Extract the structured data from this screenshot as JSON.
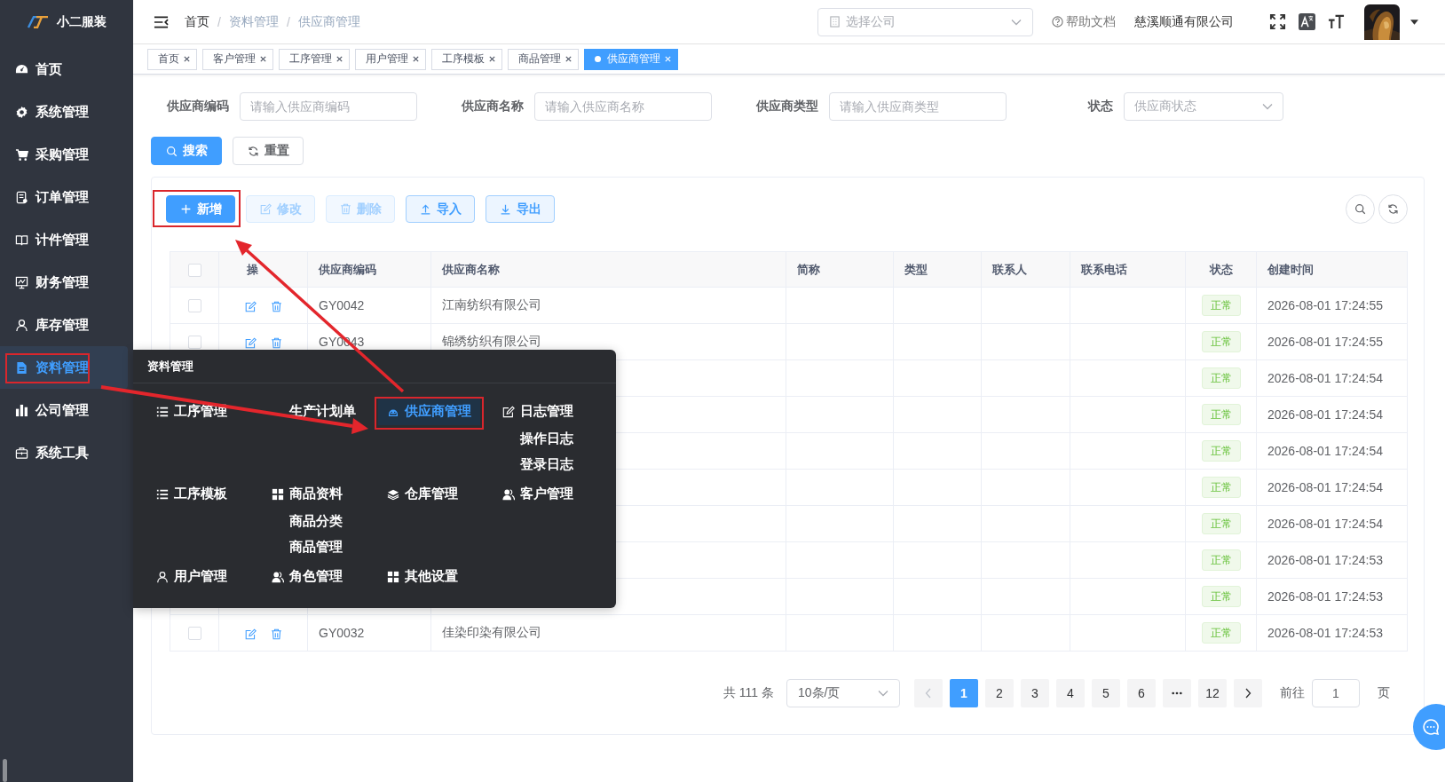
{
  "app": {
    "name": "小二服装"
  },
  "sidebar": {
    "items": [
      {
        "label": "首页",
        "selected": false
      },
      {
        "label": "系统管理",
        "selected": false
      },
      {
        "label": "采购管理",
        "selected": false
      },
      {
        "label": "订单管理",
        "selected": false
      },
      {
        "label": "计件管理",
        "selected": false
      },
      {
        "label": "财务管理",
        "selected": false
      },
      {
        "label": "库存管理",
        "selected": false
      },
      {
        "label": "资料管理",
        "selected": true
      },
      {
        "label": "公司管理",
        "selected": false
      },
      {
        "label": "系统工具",
        "selected": false
      }
    ]
  },
  "header": {
    "breadcrumb": [
      "首页",
      "资料管理",
      "供应商管理"
    ],
    "separator": "/",
    "company_select": {
      "placeholder": "选择公司"
    },
    "help": "帮助文档",
    "company": "慈溪顺通有限公司"
  },
  "tabs": [
    {
      "label": "首页",
      "selected": false
    },
    {
      "label": "客户管理",
      "selected": false
    },
    {
      "label": "工序管理",
      "selected": false
    },
    {
      "label": "用户管理",
      "selected": false
    },
    {
      "label": "工序模板",
      "selected": false
    },
    {
      "label": "商品管理",
      "selected": false
    },
    {
      "label": "供应商管理",
      "selected": true
    }
  ],
  "filters": [
    {
      "label": "供应商编码",
      "placeholder": "请输入供应商编码",
      "kind": "input"
    },
    {
      "label": "供应商名称",
      "placeholder": "请输入供应商名称",
      "kind": "input"
    },
    {
      "label": "供应商类型",
      "placeholder": "请输入供应商类型",
      "kind": "input"
    },
    {
      "label": "状态",
      "placeholder": "供应商状态",
      "kind": "select"
    }
  ],
  "search_buttons": [
    {
      "label": "搜索",
      "kind": "primary"
    },
    {
      "label": "重置",
      "kind": "default"
    }
  ],
  "toolbar": [
    {
      "label": "新增",
      "kind": "primary",
      "disabled": false
    },
    {
      "label": "修改",
      "kind": "plain",
      "disabled": true
    },
    {
      "label": "删除",
      "kind": "plain",
      "disabled": true
    },
    {
      "label": "导入",
      "kind": "plain",
      "disabled": false
    },
    {
      "label": "导出",
      "kind": "plain",
      "disabled": false
    }
  ],
  "table": {
    "select_all_checked": false,
    "columns": [
      "操",
      "供应商编码",
      "供应商名称",
      "简称",
      "类型",
      "联系人",
      "联系电话",
      "状态",
      "创建时间"
    ],
    "rows": [
      {
        "checked": false,
        "code": "GY0042",
        "name": "江南纺织有限公司",
        "status": "正常",
        "created": "2026-08-01 17:24:55"
      },
      {
        "checked": false,
        "code": "GY0043",
        "name": "锦绣纺织有限公司",
        "status": "正常",
        "created": "2026-08-01 17:24:55"
      },
      {
        "status": "正常",
        "created": "2026-08-01 17:24:54"
      },
      {
        "status": "正常",
        "created": "2026-08-01 17:24:54"
      },
      {
        "status": "正常",
        "created": "2026-08-01 17:24:54"
      },
      {
        "status": "正常",
        "created": "2026-08-01 17:24:54"
      },
      {
        "status": "正常",
        "created": "2026-08-01 17:24:54"
      },
      {
        "status": "正常",
        "created": "2026-08-01 17:24:53"
      },
      {
        "status": "正常",
        "created": "2026-08-01 17:24:53"
      },
      {
        "checked": false,
        "code": "GY0032",
        "name": "佳染印染有限公司",
        "status": "正常",
        "created": "2026-08-01 17:24:53"
      }
    ]
  },
  "pagination": {
    "total": "共 111 条",
    "page_size": "10条/页",
    "pages": [
      {
        "kind": "page",
        "label": "1",
        "selected": true
      },
      {
        "kind": "page",
        "label": "2",
        "selected": false
      },
      {
        "kind": "page",
        "label": "3",
        "selected": false
      },
      {
        "kind": "page",
        "label": "4",
        "selected": false
      },
      {
        "kind": "page",
        "label": "5",
        "selected": false
      },
      {
        "kind": "page",
        "label": "6",
        "selected": false
      },
      {
        "kind": "more",
        "selected": false
      },
      {
        "kind": "page",
        "label": "12",
        "selected": false
      }
    ],
    "goto_label": "前往",
    "goto_value": "1",
    "page_unit": "页"
  },
  "popup_menu": {
    "title": "资料管理",
    "rows": [
      {
        "groups": [
          {
            "label": "工序管理",
            "selected": false
          },
          {
            "label": "生产计划单",
            "selected": false
          },
          {
            "label": "供应商管理",
            "selected": true
          },
          {
            "label": "日志管理",
            "selected": false,
            "children": [
              "操作日志",
              "登录日志"
            ]
          }
        ]
      },
      {
        "groups": [
          {
            "label": "工序模板",
            "selected": false
          },
          {
            "label": "商品资料",
            "selected": false,
            "children": [
              "商品分类",
              "商品管理"
            ]
          },
          {
            "label": "仓库管理",
            "selected": false
          },
          {
            "label": "客户管理",
            "selected": false
          }
        ]
      },
      {
        "groups": [
          {
            "label": "用户管理",
            "selected": false
          },
          {
            "label": "角色管理",
            "selected": false
          },
          {
            "label": "其他设置",
            "selected": false
          }
        ]
      }
    ]
  }
}
